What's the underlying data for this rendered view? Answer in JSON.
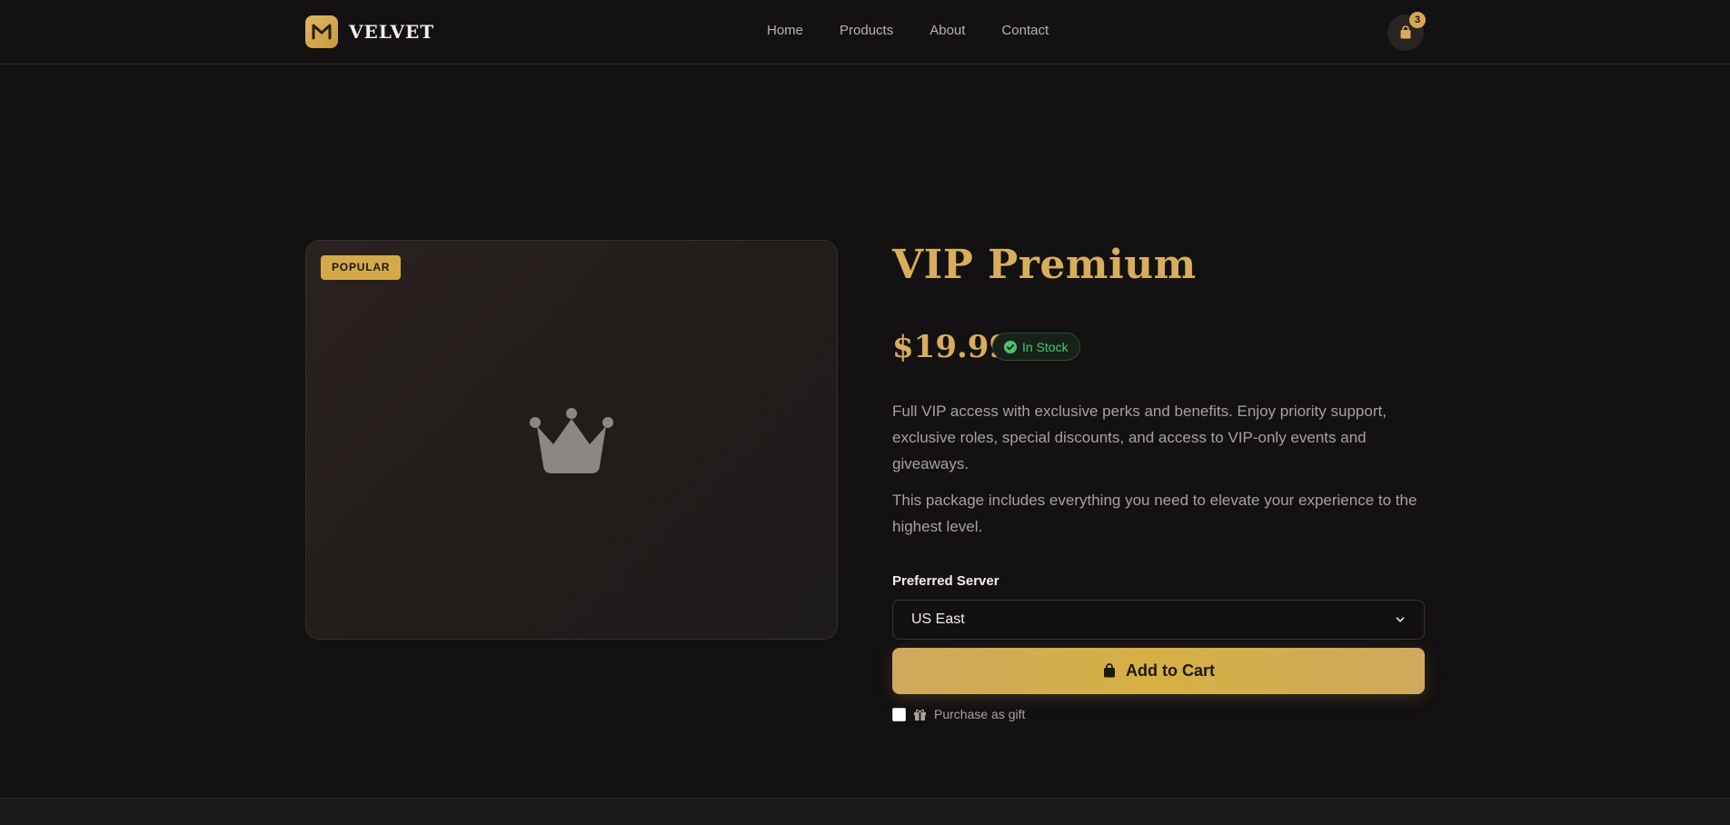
{
  "brand": {
    "name": "VELVET",
    "accent_color": "#d8ad5c"
  },
  "nav": {
    "items": [
      "Home",
      "Products",
      "About",
      "Contact"
    ]
  },
  "cart": {
    "count": "3",
    "icon": "shopping-bag-icon"
  },
  "product": {
    "badge": "POPULAR",
    "image_icon": "crown-icon",
    "title": "VIP Premium",
    "price": "$19.99",
    "stock_status": "In Stock",
    "stock_color": "#4cc46b",
    "description_1": "Full VIP access with exclusive perks and benefits. Enjoy priority support, exclusive roles, special discounts, and access to VIP-only events and giveaways.",
    "description_2": "This package includes everything you need to elevate your experience to the highest level."
  },
  "server_select": {
    "label": "Preferred Server",
    "value": "US East"
  },
  "actions": {
    "add_to_cart": "Add to Cart",
    "gift_label": "Purchase as gift",
    "gift_checked": false
  }
}
